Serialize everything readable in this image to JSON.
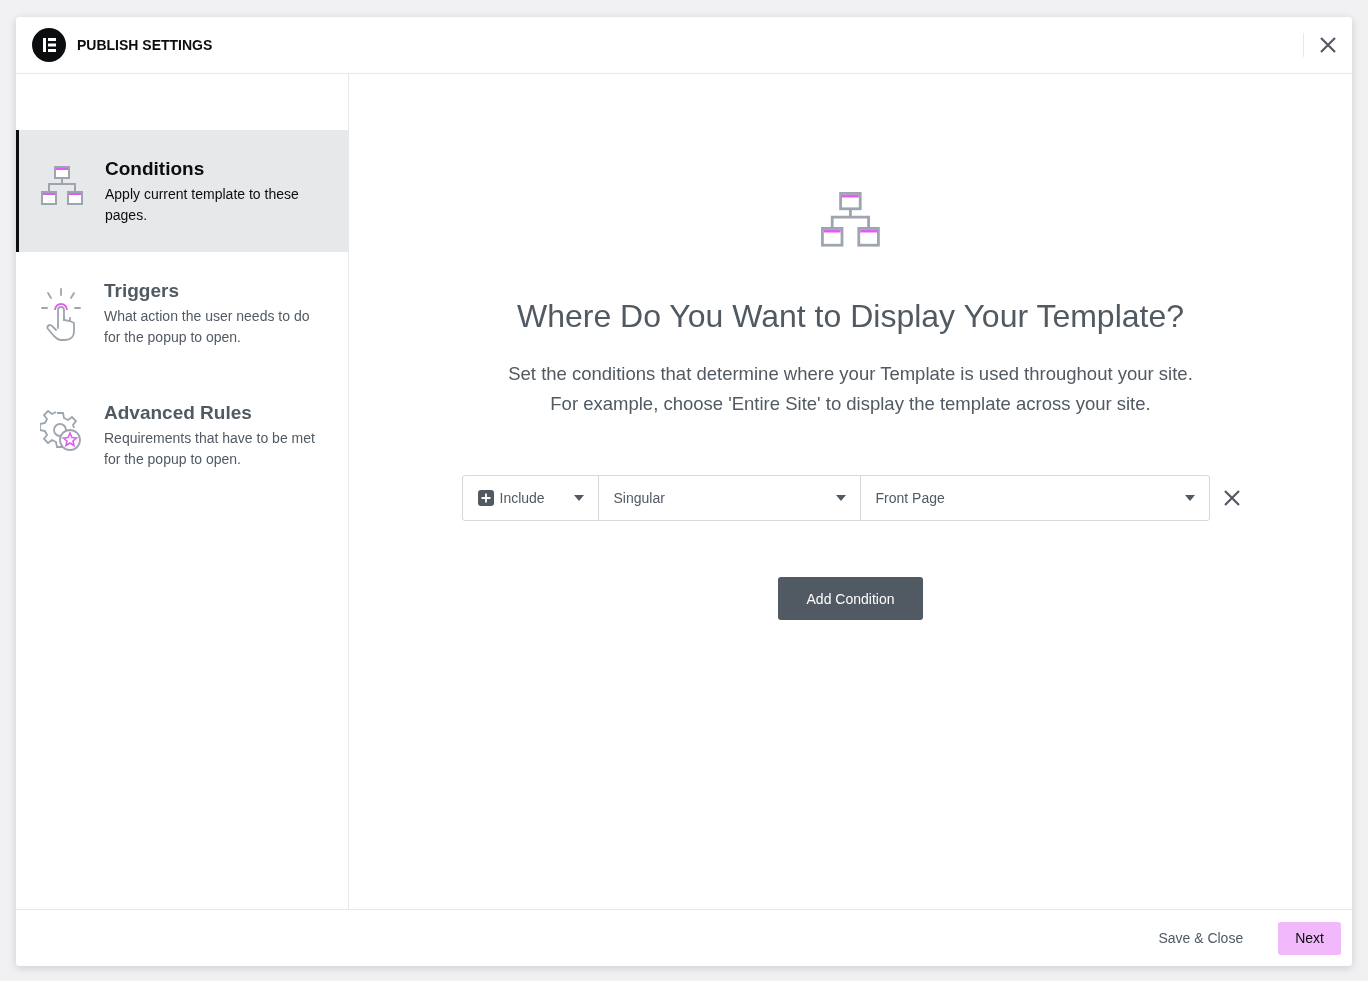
{
  "window": {
    "title": "PUBLISH SETTINGS"
  },
  "sidebar": {
    "items": [
      {
        "kind": "conditions",
        "title": "Conditions",
        "description": "Apply current template to these pages.",
        "selected": true
      },
      {
        "kind": "triggers",
        "title": "Triggers",
        "description": "What action the user needs to do for the popup to open.",
        "selected": false
      },
      {
        "kind": "rules",
        "title": "Advanced Rules",
        "description": "Requirements that have to be met for the popup to open.",
        "selected": false
      }
    ]
  },
  "main": {
    "heading": "Where Do You Want to Display Your Template?",
    "description_lines": [
      "Set the conditions that determine where your Template is used throughout your site.",
      "For example, choose 'Entire Site' to display the template across your site."
    ],
    "conditions": [
      {
        "type": "Include",
        "group": "Singular",
        "target": "Front Page"
      }
    ],
    "add_button": "Add Condition"
  },
  "footer": {
    "buttons": [
      {
        "kind": "text",
        "label": "Save & Close"
      },
      {
        "kind": "primary",
        "label": "Next"
      }
    ]
  }
}
